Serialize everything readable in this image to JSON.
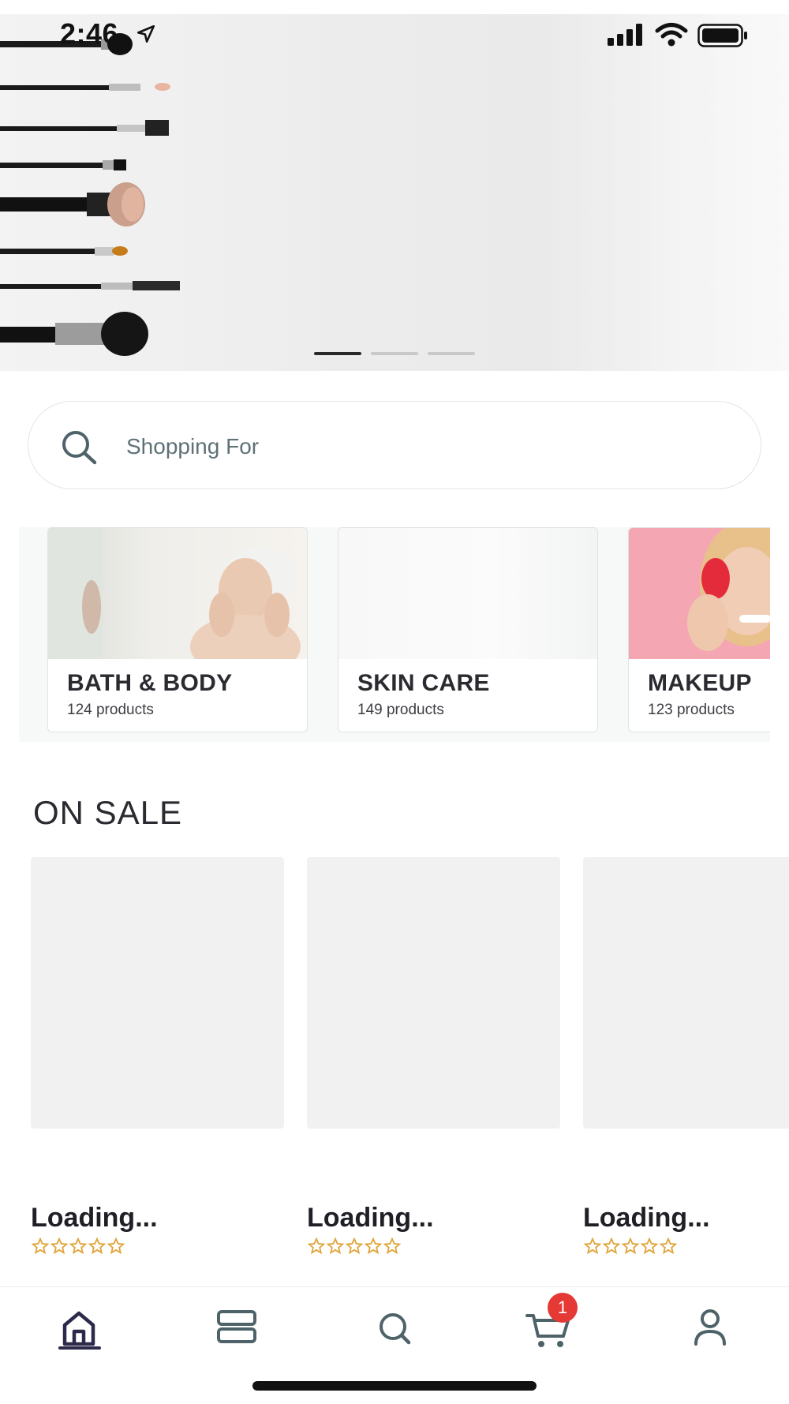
{
  "status_bar": {
    "time": "2:46"
  },
  "hero": {
    "carousel_pages": 3,
    "active_page": 1
  },
  "search": {
    "placeholder": "Shopping For",
    "value": ""
  },
  "categories": [
    {
      "title": "BATH & BODY",
      "count": "124 products"
    },
    {
      "title": "SKIN CARE",
      "count": "149 products"
    },
    {
      "title": "MAKEUP",
      "count": "123 products"
    }
  ],
  "on_sale": {
    "title": "ON SALE",
    "products": [
      {
        "name": "Loading...",
        "rating": 0
      },
      {
        "name": "Loading...",
        "rating": 0
      },
      {
        "name": "Loading...",
        "rating": 0
      }
    ]
  },
  "tab_bar": {
    "items": [
      "home-icon",
      "categories-icon",
      "search-icon",
      "cart-icon",
      "profile-icon"
    ],
    "active": "home",
    "cart_badge": "1"
  },
  "colors": {
    "accent": "#2b2a4a",
    "badge": "#e53935",
    "star": "#e0a43a"
  }
}
